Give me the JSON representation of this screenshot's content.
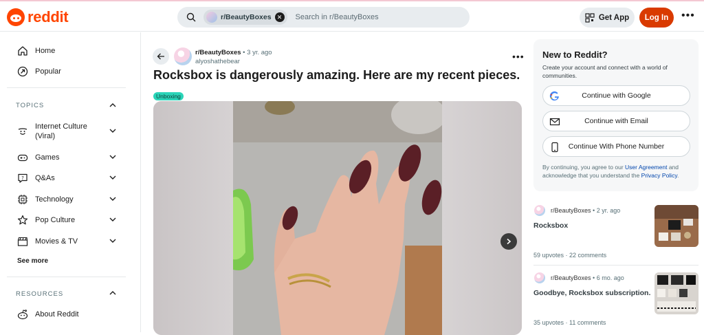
{
  "header": {
    "logo_text": "reddit",
    "search_chip": "r/BeautyBoxes",
    "search_placeholder": "Search in r/BeautyBoxes",
    "get_app": "Get App",
    "login": "Log In",
    "more_icon": "ellipsis-icon"
  },
  "sidebar": {
    "home": "Home",
    "popular": "Popular",
    "topics_header": "TOPICS",
    "topics": [
      {
        "label": "Internet Culture\n(Viral)",
        "icon": "smile-icon"
      },
      {
        "label": "Games",
        "icon": "gamepad-icon"
      },
      {
        "label": "Q&As",
        "icon": "question-icon"
      },
      {
        "label": "Technology",
        "icon": "chip-icon"
      },
      {
        "label": "Pop Culture",
        "icon": "star-icon"
      },
      {
        "label": "Movies & TV",
        "icon": "clapper-icon"
      }
    ],
    "see_more": "See more",
    "resources_header": "RESOURCES",
    "about": "About Reddit"
  },
  "post": {
    "subreddit": "r/BeautyBoxes",
    "age": "3 yr. ago",
    "author": "alyoshathebear",
    "title": "Rocksbox is dangerously amazing. Here are my recent pieces.",
    "flair": "Unboxing",
    "flair_color": "#2ad4b8"
  },
  "signup": {
    "title": "New to Reddit?",
    "description": "Create your account and connect with a world of communities.",
    "google": "Continue with Google",
    "email": "Continue with Email",
    "phone": "Continue With Phone Number",
    "legal_pre": "By continuing, you agree to our ",
    "legal_link1": "User Agreement",
    "legal_mid": " and acknowledge that you understand the ",
    "legal_link2": "Privacy Policy",
    "legal_post": "."
  },
  "related": [
    {
      "subreddit": "r/BeautyBoxes",
      "age": "2 yr. ago",
      "title": "Rocksbox",
      "upvotes": "59 upvotes",
      "comments": "22 comments"
    },
    {
      "subreddit": "r/BeautyBoxes",
      "age": "6 mo. ago",
      "title": "Goodbye, Rocksbox subscription...",
      "upvotes": "35 upvotes",
      "comments": "11 comments"
    }
  ],
  "colors": {
    "brand": "#ff4500",
    "login": "#d93a00",
    "link": "#0045ac"
  }
}
